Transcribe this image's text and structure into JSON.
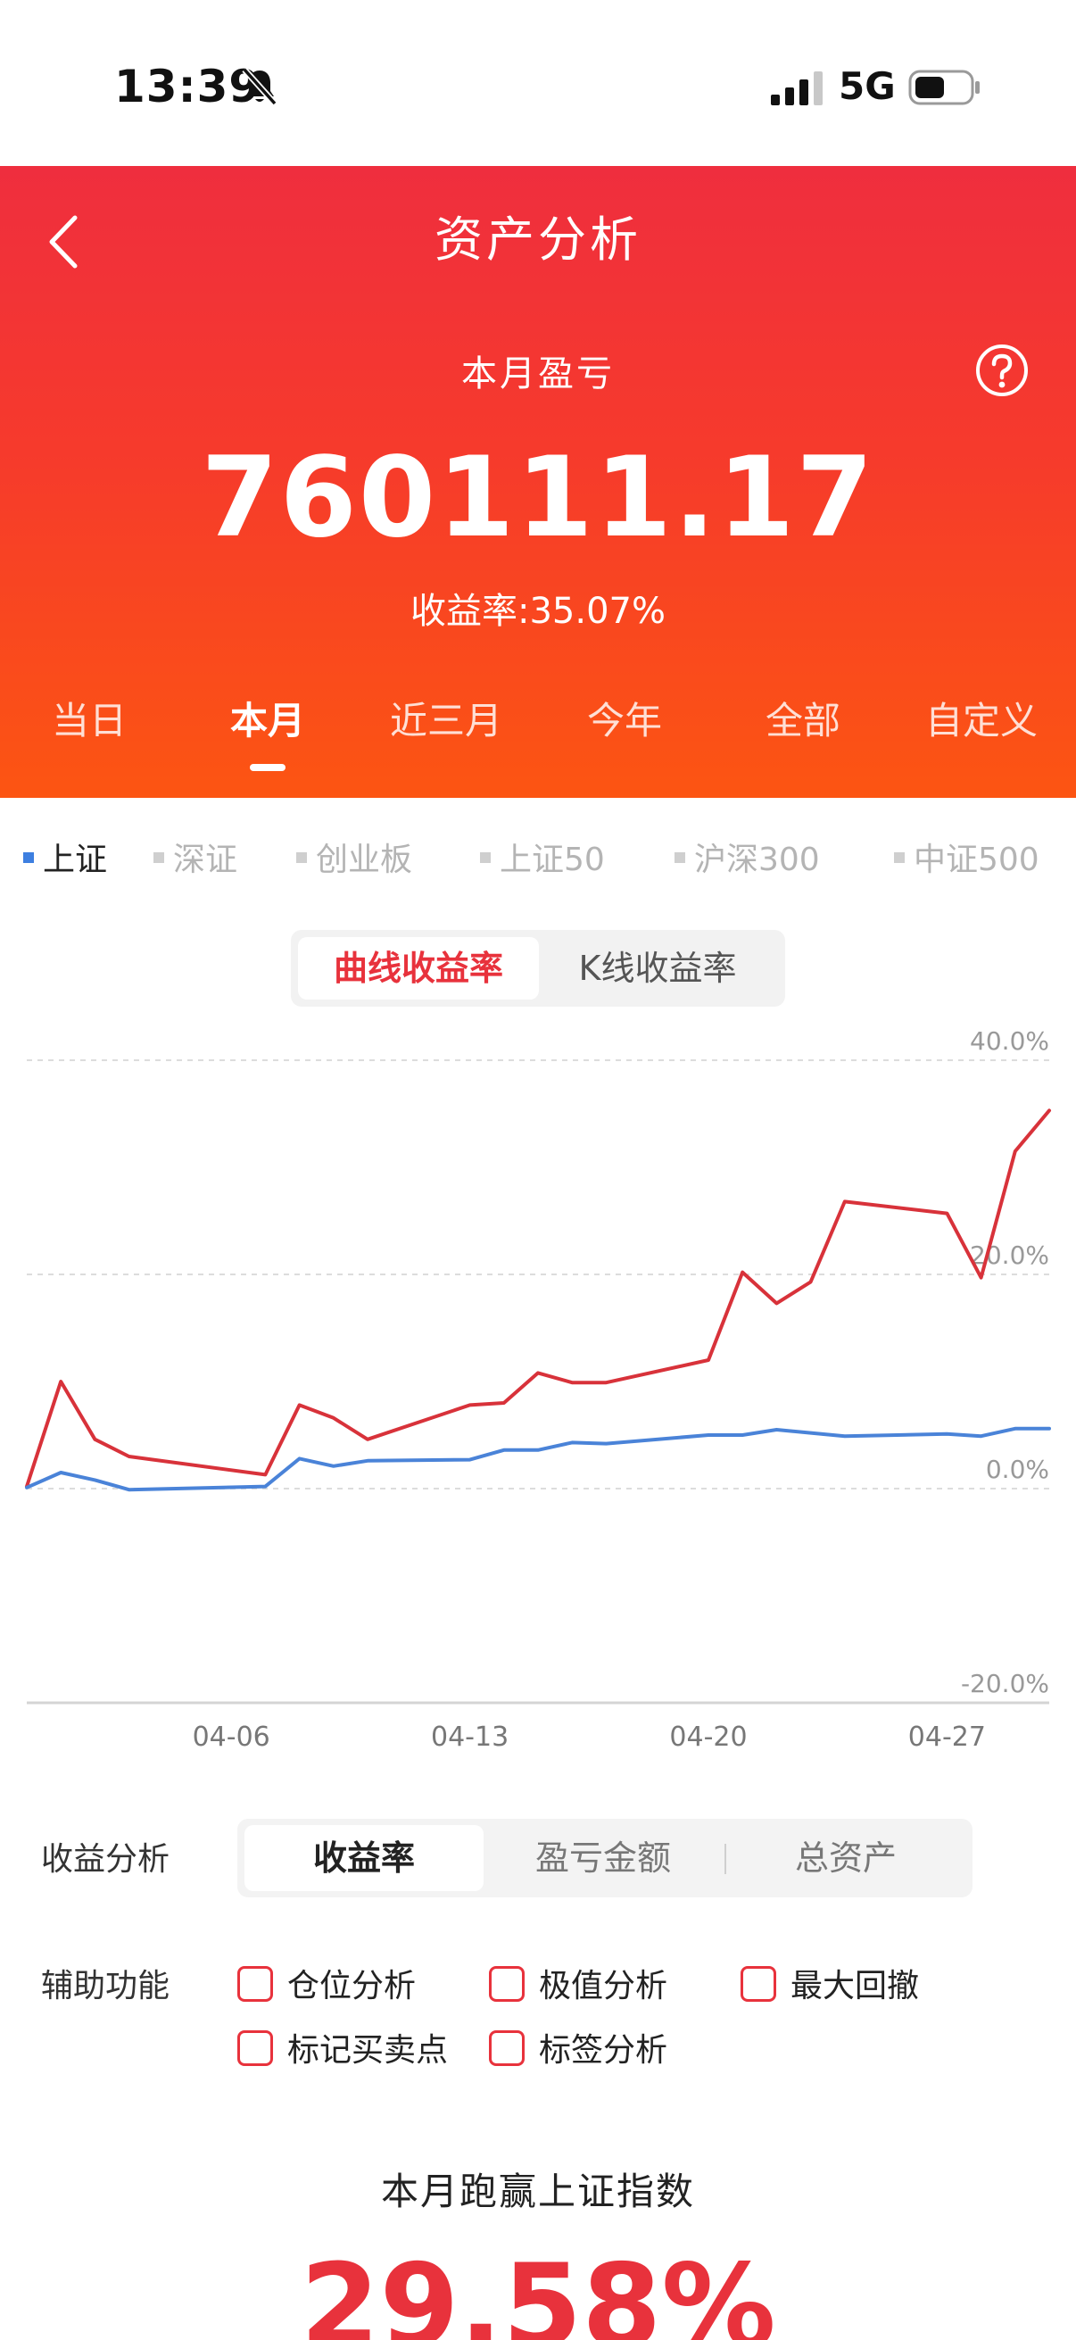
{
  "status_bar": {
    "time": "13:39",
    "network": "5G"
  },
  "header": {
    "title": "资产分析",
    "month_label": "本月盈亏",
    "pnl_value": "760111.17",
    "yield_text": "收益率:35.07%"
  },
  "period_tabs": [
    {
      "label": "当日"
    },
    {
      "label": "本月",
      "active": true
    },
    {
      "label": "近三月"
    },
    {
      "label": "今年"
    },
    {
      "label": "全部"
    },
    {
      "label": "自定义"
    }
  ],
  "index_selector": [
    {
      "label": "上证",
      "active": true
    },
    {
      "label": "深证"
    },
    {
      "label": "创业板"
    },
    {
      "label": "上证50"
    },
    {
      "label": "沪深300"
    },
    {
      "label": "中证500"
    }
  ],
  "chart_mode": {
    "active": "曲线收益率",
    "other": "K线收益率"
  },
  "chart_data": {
    "type": "line",
    "y_tick_labels": [
      "40.0%",
      "20.0%",
      "0.0%",
      "-20.0%"
    ],
    "ylim": [
      -20,
      40
    ],
    "x_tick_labels": [
      "04-06",
      "04-13",
      "04-20",
      "04-27"
    ],
    "x_tick_positions": [
      7,
      14,
      21,
      28
    ],
    "xlim": [
      1,
      31
    ],
    "grid": true,
    "colors": {
      "portfolio": "#d8323a",
      "index": "#4a83d8"
    },
    "series": [
      {
        "key": "portfolio",
        "x": [
          1,
          2,
          3,
          4,
          8,
          9,
          10,
          11,
          14,
          15,
          16,
          17,
          18,
          21,
          22,
          23,
          24,
          25,
          28,
          29,
          30,
          31
        ],
        "y": [
          0.2,
          10,
          4.6,
          3.0,
          1.3,
          7.8,
          6.6,
          4.6,
          7.8,
          8.0,
          10.8,
          9.9,
          9.9,
          12.0,
          20.2,
          17.3,
          19.3,
          26.8,
          25.7,
          19.7,
          31.5,
          35.3
        ]
      },
      {
        "key": "index",
        "x": [
          1,
          2,
          3,
          4,
          8,
          9,
          10,
          11,
          14,
          15,
          16,
          17,
          18,
          21,
          22,
          23,
          24,
          25,
          28,
          29,
          30,
          31
        ],
        "y": [
          0.1,
          1.5,
          0.8,
          -0.1,
          0.2,
          2.8,
          2.1,
          2.6,
          2.7,
          3.6,
          3.6,
          4.3,
          4.2,
          5.0,
          5.0,
          5.5,
          5.2,
          4.9,
          5.1,
          4.9,
          5.6,
          5.6
        ]
      }
    ]
  },
  "analysis": {
    "label": "收益分析",
    "tabs": [
      {
        "label": "收益率",
        "active": true
      },
      {
        "label": "盈亏金额"
      },
      {
        "label": "总资产"
      }
    ]
  },
  "aux": {
    "label": "辅助功能",
    "options": [
      {
        "label": "仓位分析"
      },
      {
        "label": "极值分析"
      },
      {
        "label": "最大回撤"
      },
      {
        "label": "标记买卖点"
      },
      {
        "label": "标签分析"
      }
    ]
  },
  "outperform": {
    "label": "本月跑赢上证指数",
    "value": "29.58%"
  }
}
